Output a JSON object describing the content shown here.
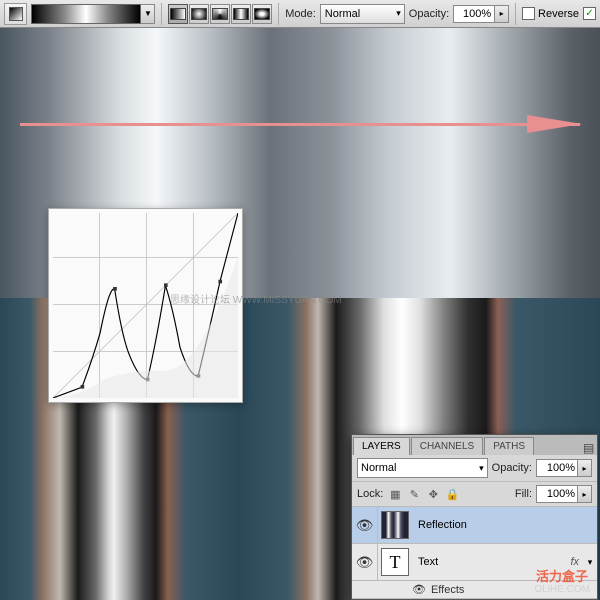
{
  "toolbar": {
    "mode_label": "Mode:",
    "mode_value": "Normal",
    "opacity_label": "Opacity:",
    "opacity_value": "100%",
    "reverse_label": "Reverse",
    "reverse_checked": false,
    "dither_checked": true
  },
  "watermarks": {
    "center": "思缘设计论坛  WWW.MISSYUAN.COM",
    "corner_red": "活力盒子",
    "corner_url": "OLiHE.COM"
  },
  "layers_panel": {
    "tabs": [
      "LAYERS",
      "CHANNELS",
      "PATHS"
    ],
    "active_tab": "LAYERS",
    "blend_mode": "Normal",
    "opacity_label": "Opacity:",
    "opacity_value": "100%",
    "lock_label": "Lock:",
    "fill_label": "Fill:",
    "fill_value": "100%",
    "layers": [
      {
        "name": "Reflection",
        "visible": true,
        "selected": true,
        "thumb": "striped"
      },
      {
        "name": "Text",
        "visible": true,
        "selected": false,
        "thumb": "T",
        "fx": true
      }
    ],
    "effects_label": "Effects"
  },
  "chart_data": {
    "type": "line",
    "note": "Photoshop curves adjustment – W-shaped curve",
    "xlim": [
      0,
      255
    ],
    "ylim": [
      0,
      255
    ],
    "points": [
      {
        "x": 0,
        "y": 0
      },
      {
        "x": 40,
        "y": 15
      },
      {
        "x": 65,
        "y": 90
      },
      {
        "x": 85,
        "y": 150
      },
      {
        "x": 105,
        "y": 60
      },
      {
        "x": 130,
        "y": 25
      },
      {
        "x": 155,
        "y": 155
      },
      {
        "x": 175,
        "y": 70
      },
      {
        "x": 200,
        "y": 30
      },
      {
        "x": 230,
        "y": 160
      },
      {
        "x": 255,
        "y": 255
      }
    ]
  }
}
